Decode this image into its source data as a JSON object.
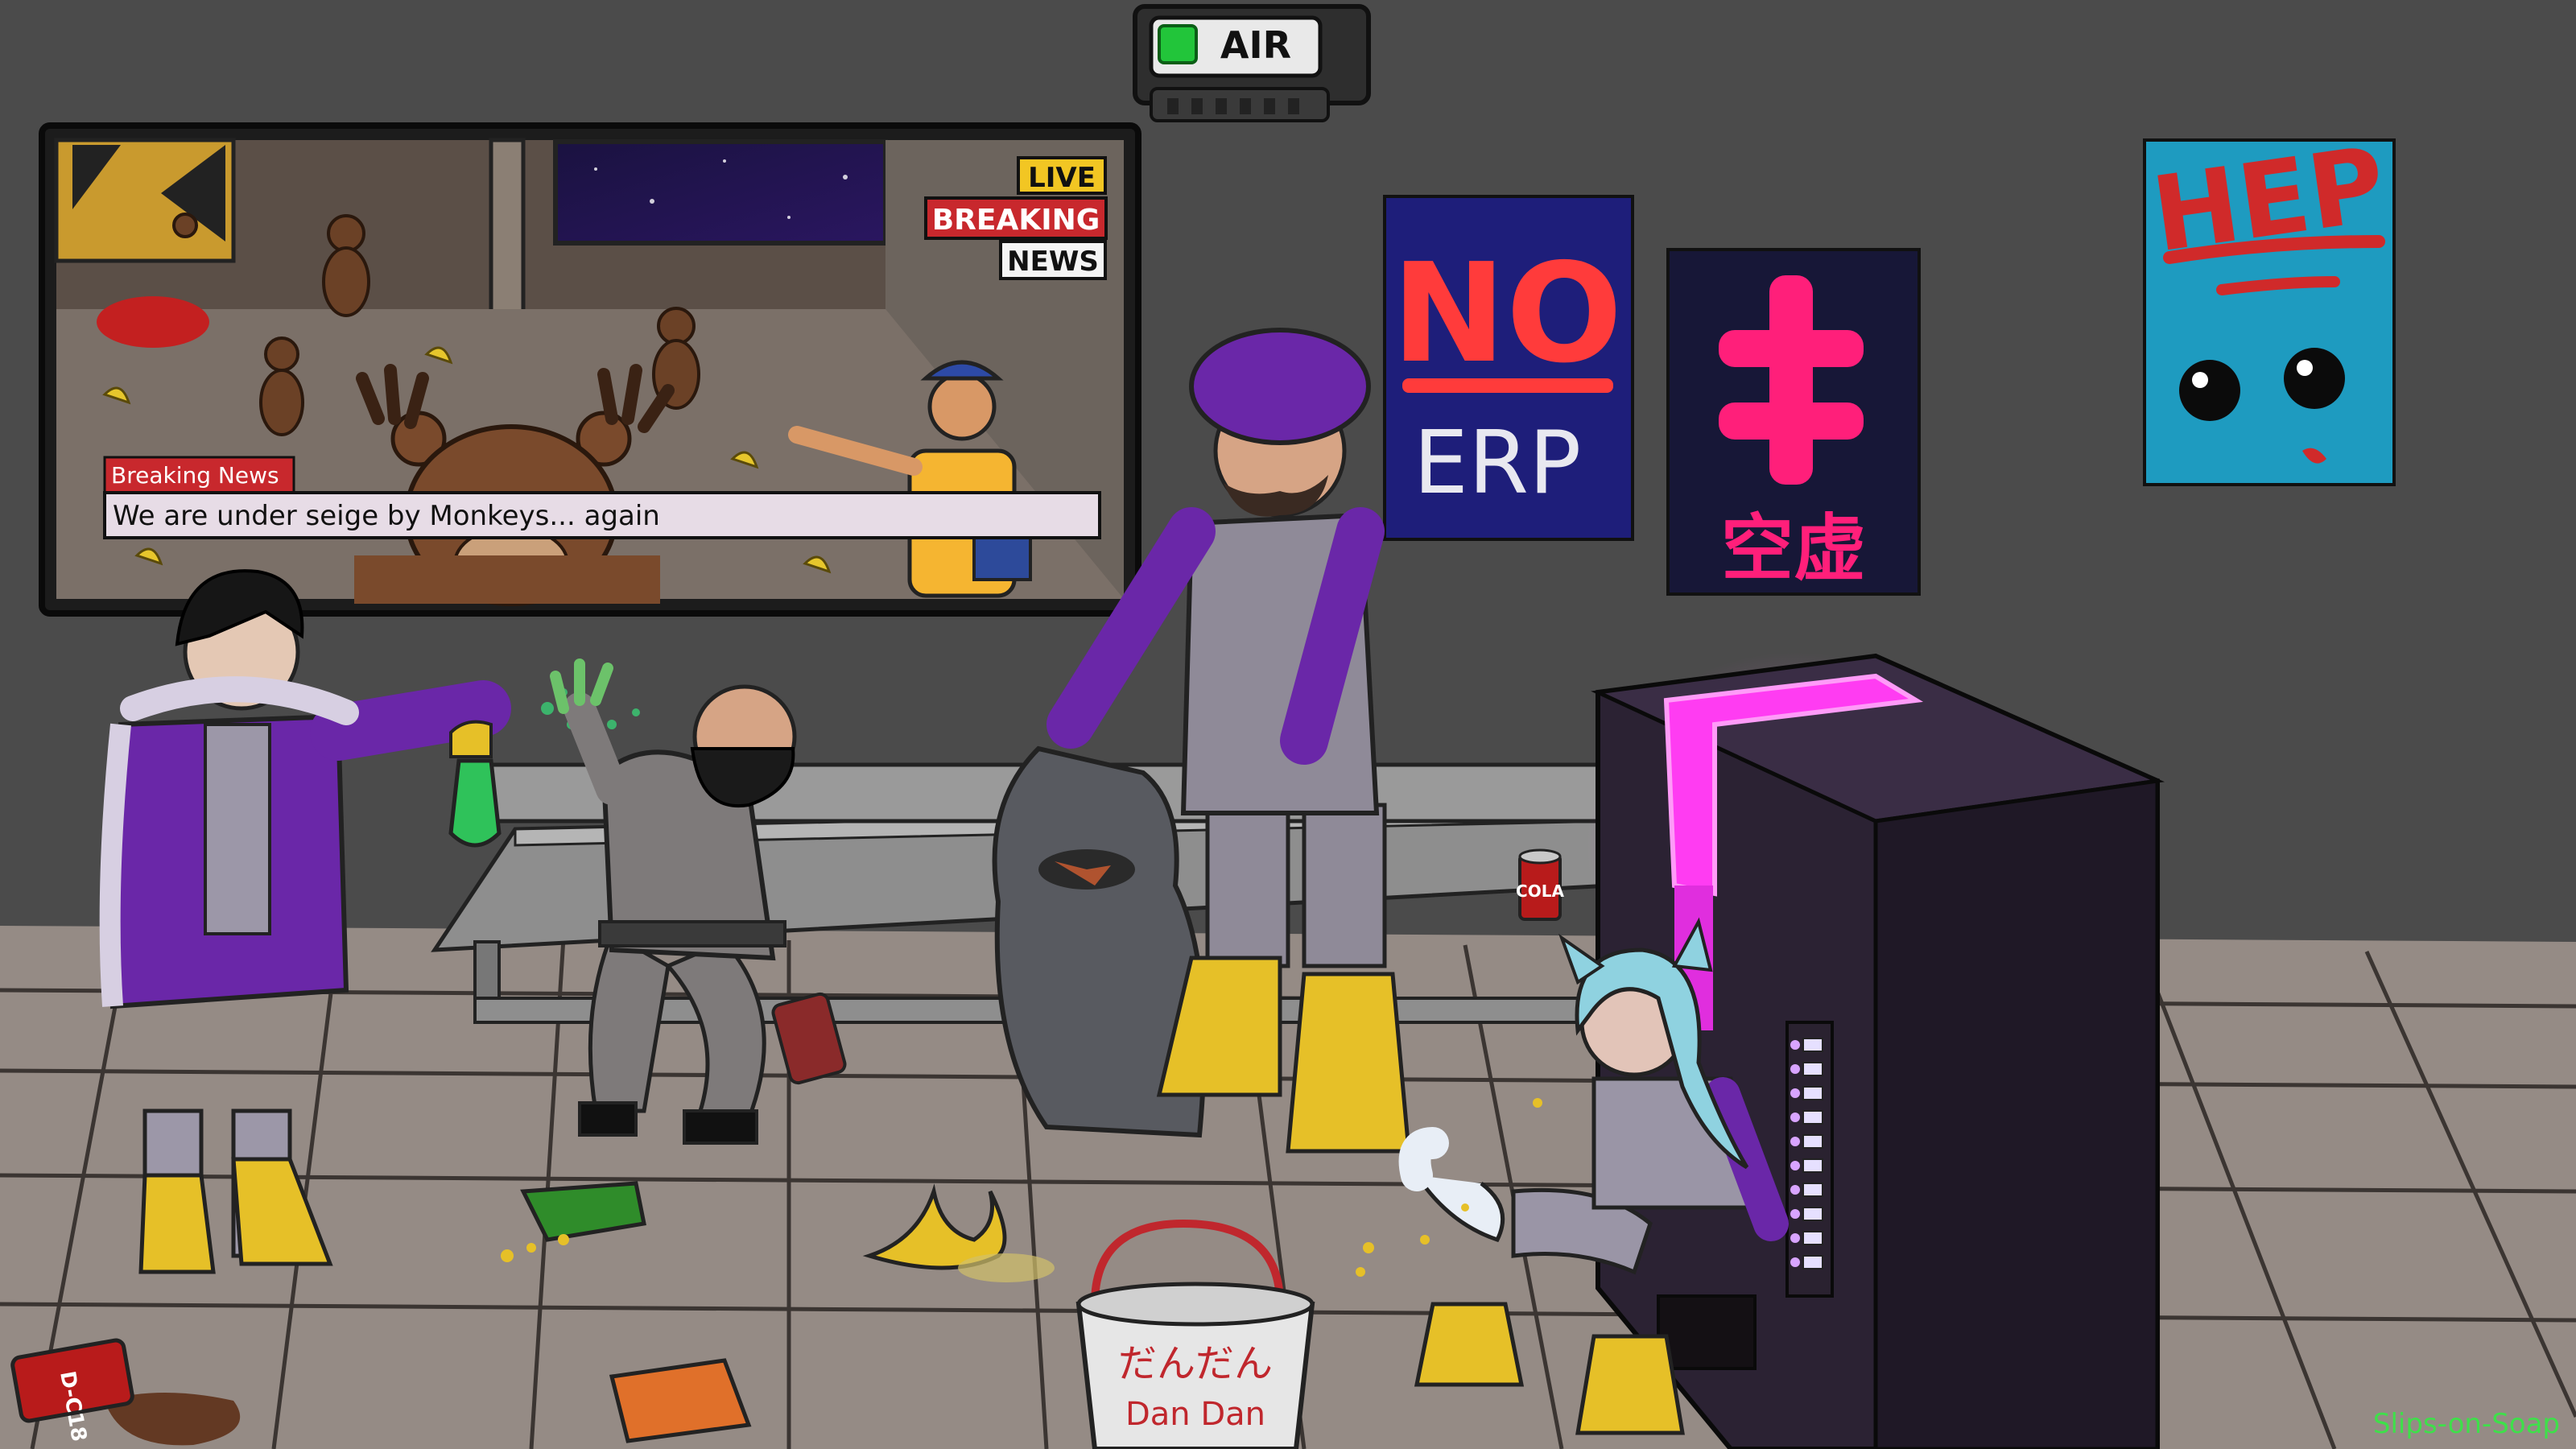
{
  "air_sign": {
    "label": "AIR",
    "indicator_color": "#22c53a"
  },
  "tv": {
    "live_label": "LIVE",
    "breaking_label": "BREAKING",
    "news_label": "NEWS",
    "ticker_title": "Breaking News",
    "ticker_text": "We are under seige by Monkeys... again"
  },
  "posters": {
    "no_erp": {
      "line1": "NO",
      "line2": "ERP"
    },
    "kanji": {
      "text": "空虚"
    },
    "hep": {
      "text": "HEP"
    }
  },
  "cola_can": {
    "label": "COLA"
  },
  "floor_can": {
    "label": "D-C18"
  },
  "bucket": {
    "line1": "だんだん",
    "line2": "Dan Dan"
  },
  "signature": "Slips-on-Soap",
  "colors": {
    "wall": "#4b4b4b",
    "floor": "#9a8f88",
    "purple": "#6a27a8",
    "boots": "#e6c028",
    "vending_glow": "#ff3cf2"
  }
}
